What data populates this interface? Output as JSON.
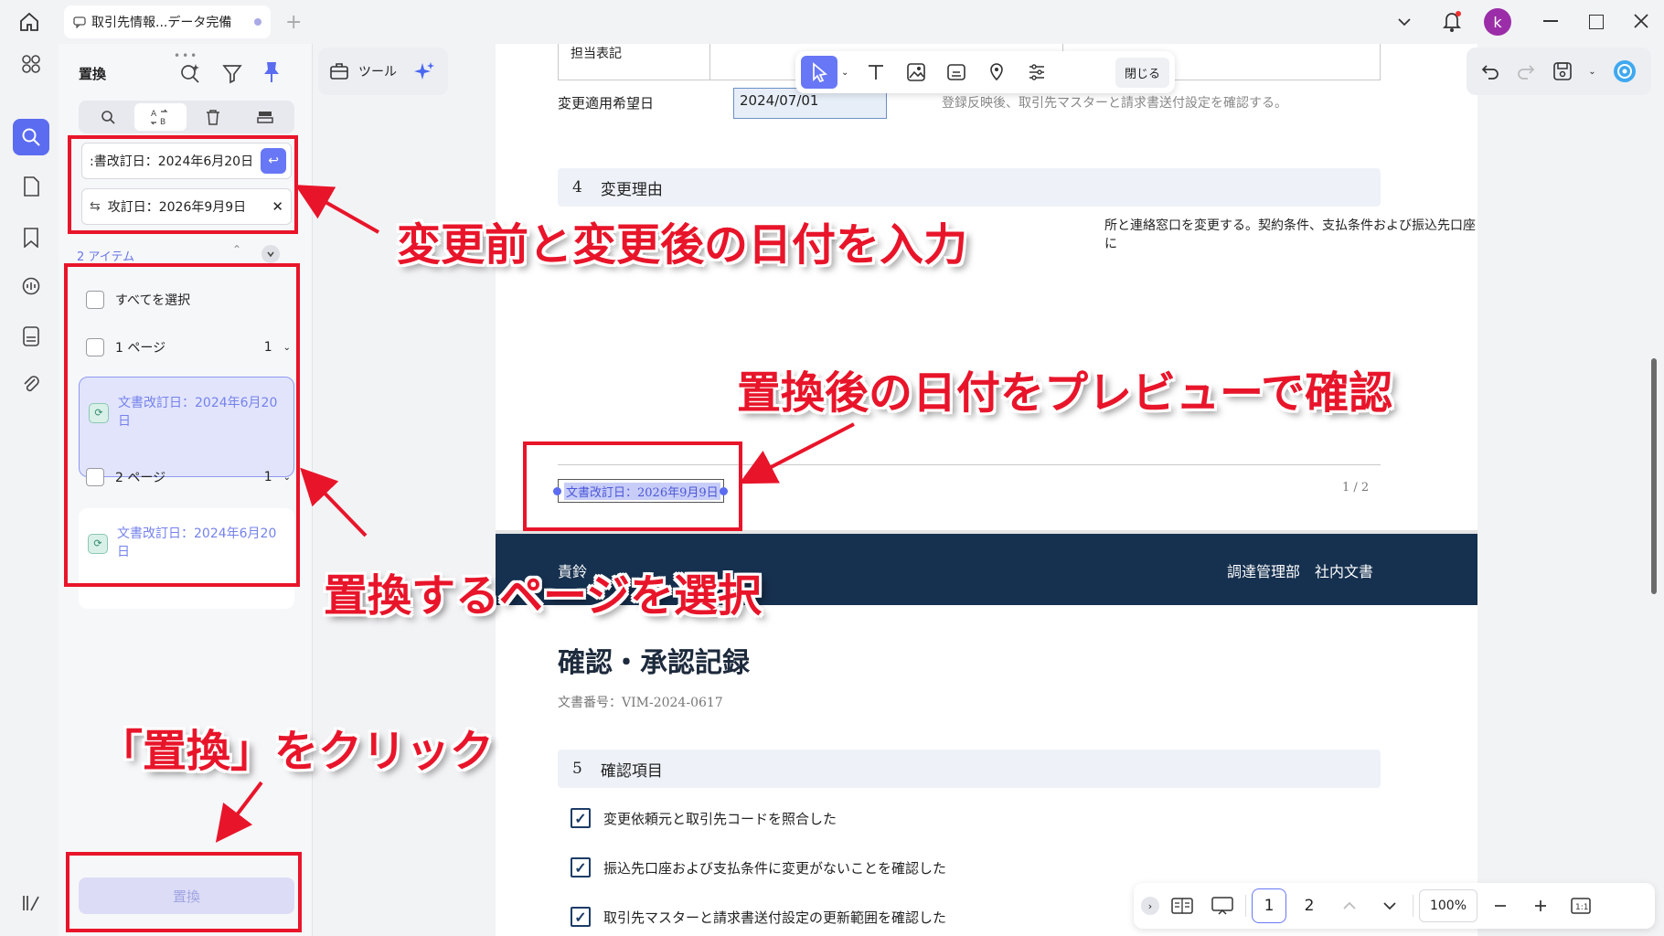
{
  "tab": {
    "title": "取引先情報...データ完備"
  },
  "window": {
    "avatar_letter": "k"
  },
  "panel": {
    "title": "置換",
    "find_value": ":書改訂日：2024年6月20日",
    "replace_value": "攻訂日：2026年9月9日",
    "result_count": "2 アイテム",
    "select_all": "すべてを選択",
    "pages": [
      {
        "label": "1 ページ",
        "count": "1",
        "result": "文書改訂日：2024年6月20日"
      },
      {
        "label": "2 ページ",
        "count": "1",
        "result": "文書改訂日：2024年6月20日"
      }
    ],
    "replace_button": "置換"
  },
  "toolbar": {
    "tools_label": "ツール",
    "close_label": "閉じる"
  },
  "document": {
    "row_label": "担当表記",
    "date_label": "変更適用希望日",
    "date_value": "2024/07/01",
    "date_note": "登録反映後、取引先マスターと請求書送付設定を確認する。",
    "sec4_num": "4",
    "sec4_title": "変更理由",
    "sec4_body": "所と連絡窓口を変更する。契約条件、支払条件および振込先口座に",
    "footer_text": "文書改訂日：2026年9月9日",
    "page_indicator": "1 / 2",
    "header_left": "責鈴",
    "header_right": "調達管理部　社内文書",
    "page2_title": "確認・承認記録",
    "doc_number": "文書番号：VIM-2024-0617",
    "sec5_num": "5",
    "sec5_title": "確認項目",
    "checks": [
      "変更依頼元と取引先コードを照合した",
      "振込先口座および支払条件に変更がないことを確認した",
      "取引先マスターと請求書送付設定の更新範囲を確認した"
    ]
  },
  "bottombar": {
    "page1": "1",
    "page2": "2",
    "zoom": "100%"
  },
  "annotations": {
    "input_dates": "変更前と変更後の日付を入力",
    "preview": "置換後の日付をプレビューで確認",
    "select_pages": "置換するページを選択",
    "click_replace": "「置換」をクリック"
  }
}
